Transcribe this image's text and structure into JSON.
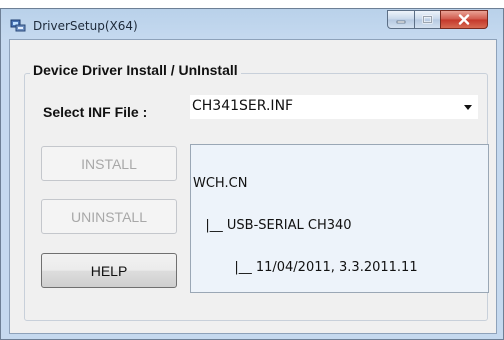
{
  "window": {
    "title": "DriverSetup(X64)"
  },
  "group": {
    "title": "Device Driver Install / UnInstall"
  },
  "inf": {
    "label": "Select INF File :",
    "value": "CH341SER.INF"
  },
  "buttons": {
    "install": "INSTALL",
    "uninstall": "UNINSTALL",
    "help": "HELP"
  },
  "info": {
    "lines": [
      "WCH.CN",
      "   |__ USB-SERIAL CH340",
      "          |__ 11/04/2011, 3.3.2011.11"
    ]
  },
  "icons": {
    "app": "driver-setup-icon",
    "minimize": "minimize-icon",
    "maximize": "maximize-icon",
    "close": "close-icon",
    "dropdown": "chevron-down-icon"
  }
}
